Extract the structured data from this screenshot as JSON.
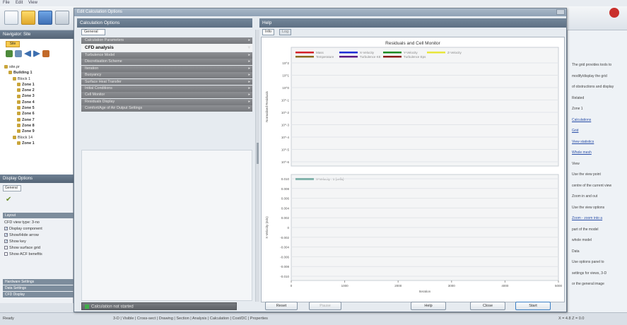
{
  "colors": {
    "panel_header": "#5e7083",
    "category_bar": "#808286",
    "legend_mass": "#d3212a",
    "legend_x_velocity": "#1f2fd6",
    "legend_y_velocity": "#1e8b24",
    "legend_z_velocity": "#e8e63c",
    "legend_temperature": "#8a6a1e",
    "legend_turbulence_ke": "#5b1a84",
    "legend_turbulence_eps": "#8b1c1c",
    "legend_x_velocity_lower": "#1e7d6c"
  },
  "dialog": {
    "title": "Edit Calculation Options",
    "calc_panel": {
      "title": "Calculation Options",
      "tab": "General",
      "categories": [
        {
          "label": "Calculation Parameters",
          "open": false
        },
        {
          "label": "CFD analysis",
          "open": true
        },
        {
          "label": "Turbulence Model",
          "open": false
        },
        {
          "label": "Discretisation Scheme",
          "open": false
        },
        {
          "label": "Iteration",
          "open": false
        },
        {
          "label": "Buoyancy",
          "open": false
        },
        {
          "label": "Surface Heat Transfer",
          "open": false
        },
        {
          "label": "Initial Conditions",
          "open": false
        },
        {
          "label": "Cell Monitor",
          "open": false
        },
        {
          "label": "Residuals Display",
          "open": false
        },
        {
          "label": "Comfort/Age of Air Output Settings",
          "open": false
        }
      ],
      "start_status": "Calculation not started"
    },
    "help_panel": {
      "title": "Help",
      "tabs": [
        {
          "label": "Info",
          "active": true
        },
        {
          "label": "Log",
          "active": false
        }
      ]
    },
    "buttons": [
      {
        "label": "Reset",
        "enabled": true
      },
      {
        "label": "Pause",
        "enabled": false
      },
      {
        "label": "Help",
        "enabled": true
      },
      {
        "label": "Close",
        "enabled": true
      },
      {
        "label": "Start",
        "enabled": true
      }
    ]
  },
  "chart_data": [
    {
      "type": "line",
      "title": "Residuals and Cell Monitor",
      "ylabel": "Normalised Residuals",
      "scale": "log",
      "tick_labels_y": [
        "10^2",
        "10^1",
        "10^0",
        "10^-1",
        "10^-2",
        "10^-3",
        "10^-4",
        "10^-5",
        "10^-6"
      ],
      "series": [
        {
          "name": "Mass",
          "values": []
        },
        {
          "name": "X-Velocity",
          "values": []
        },
        {
          "name": "Y-Velocity",
          "values": []
        },
        {
          "name": "Z-Velocity",
          "values": []
        },
        {
          "name": "Temperature",
          "values": []
        },
        {
          "name": "Turbulence KE",
          "values": []
        },
        {
          "name": "Turbulence Eps",
          "values": []
        }
      ],
      "legend": "top",
      "grid": true
    },
    {
      "type": "line",
      "xlabel": "Iteration",
      "ylabel": "X-Velocity (m/s)",
      "x_ticks": [
        "0",
        "1000",
        "2000",
        "3000",
        "4000",
        "5000"
      ],
      "xlim": [
        0,
        5000
      ],
      "y_ticks": [
        "0.010",
        "0.008",
        "0.006",
        "0.004",
        "0.002",
        "0",
        "-0.002",
        "-0.004",
        "-0.006",
        "-0.008",
        "-0.010"
      ],
      "ylim": [
        -0.01,
        0.01
      ],
      "series": [
        {
          "name": "X-Velocity : 1 (cells)",
          "values": []
        }
      ],
      "legend": "top-left",
      "grid": true
    }
  ],
  "app": {
    "menubar": [
      "File",
      "Edit",
      "View"
    ],
    "navigator": {
      "title": "Navigator: Site",
      "tab": "Site",
      "tree": [
        {
          "label": "site.pr",
          "indent": 0,
          "bold": false
        },
        {
          "label": "Building 1",
          "indent": 1,
          "bold": true
        },
        {
          "label": "Block 1",
          "indent": 2,
          "bold": false
        },
        {
          "label": "Zone 1",
          "indent": 3,
          "bold": true
        },
        {
          "label": "Zone 2",
          "indent": 3,
          "bold": true
        },
        {
          "label": "Zone 3",
          "indent": 3,
          "bold": true
        },
        {
          "label": "Zone 4",
          "indent": 3,
          "bold": true
        },
        {
          "label": "Zone 5",
          "indent": 3,
          "bold": true
        },
        {
          "label": "Zone 6",
          "indent": 3,
          "bold": true
        },
        {
          "label": "Zone 7",
          "indent": 3,
          "bold": true
        },
        {
          "label": "Zone 8",
          "indent": 3,
          "bold": true
        },
        {
          "label": "Zone 9",
          "indent": 3,
          "bold": true
        },
        {
          "label": "Block 14",
          "indent": 2,
          "bold": false
        },
        {
          "label": "Zone 1",
          "indent": 3,
          "bold": true
        }
      ]
    },
    "display_options": {
      "title": "Display Options",
      "tab": "General",
      "section": "Layout",
      "options": [
        {
          "label": "CFD view type: 3-no",
          "checked": null
        },
        {
          "label": "Display component",
          "checked": true
        },
        {
          "label": "Show/Hide arrow",
          "checked": true
        },
        {
          "label": "Show key",
          "checked": true
        },
        {
          "label": "Show surface grid",
          "checked": false
        },
        {
          "label": "Show ACF benefits",
          "checked": false
        }
      ],
      "lower_sections": [
        "Hardware Settings",
        "Data Settings",
        "CFD Display"
      ]
    },
    "info_panel": {
      "lines": [
        {
          "text": "The grid provides tools to",
          "link": false
        },
        {
          "text": "modify/display the grid",
          "link": false
        },
        {
          "text": "of obstructions and display",
          "link": false
        },
        {
          "text": "Related",
          "link": false
        },
        {
          "text": "Zone 1",
          "link": false
        },
        {
          "text": "Calculations",
          "link": true
        },
        {
          "text": "Grid",
          "link": true
        },
        {
          "text": "View statistics",
          "link": true
        },
        {
          "text": "Whole mesh",
          "link": true
        },
        {
          "text": "View",
          "link": false
        },
        {
          "text": "Use the view point",
          "link": false
        },
        {
          "text": "centre of the current view",
          "link": false
        },
        {
          "text": "Zoom in and out",
          "link": false
        },
        {
          "text": "Use the view options",
          "link": false
        },
        {
          "text": "Zoom - zoom into a",
          "link": true
        },
        {
          "text": "part of the model",
          "link": false
        },
        {
          "text": "whole model",
          "link": false
        },
        {
          "text": "Data",
          "link": false
        },
        {
          "text": "Use options panel to",
          "link": false
        },
        {
          "text": "settings for views, 3-D",
          "link": false
        },
        {
          "text": "or the general image",
          "link": false
        }
      ]
    },
    "status_bar": {
      "left": "Ready",
      "tabs": "3-D | Visible | Cross-sect | Drawing | Section | Analysis | Calculation | Cost/DC | Properties",
      "right": "X = 4.8 Z = 0.0"
    }
  }
}
